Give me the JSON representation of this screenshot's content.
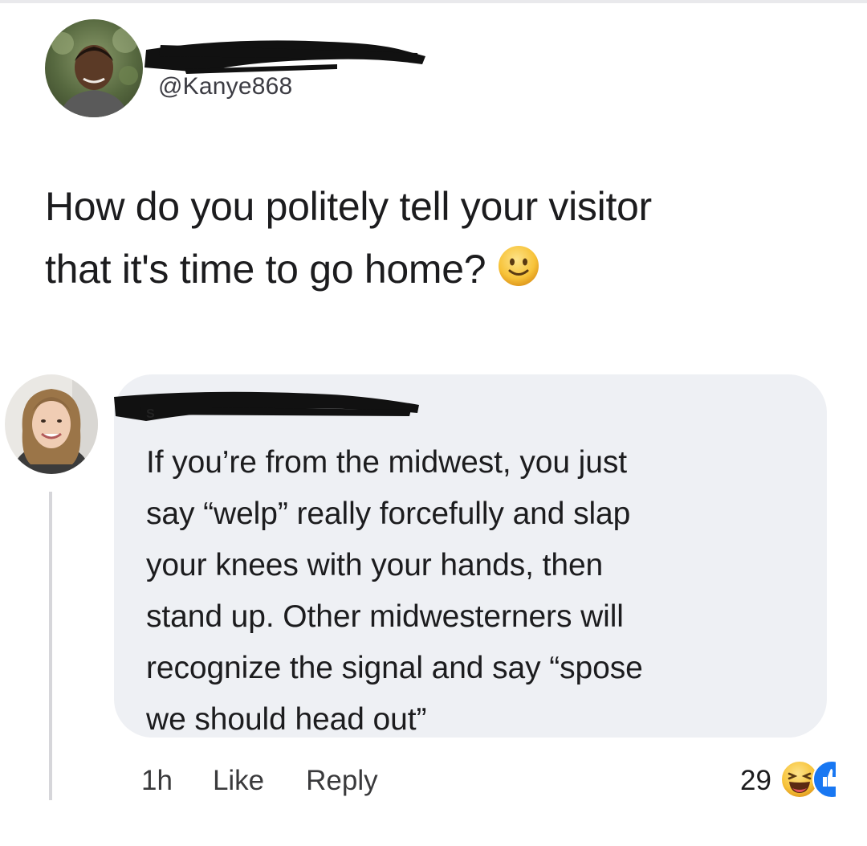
{
  "post": {
    "handle": "@Kanye868",
    "text_lines": [
      "How do you politely tell your visitor",
      "that it's time to go home?"
    ],
    "emoji": "slightly-smiling-face-icon"
  },
  "comment": {
    "text_lines": [
      "If you’re from the midwest, you just",
      "say “welp” really forcefully and slap",
      "your knees with your hands, then",
      "stand up. Other midwesterners will",
      "recognize the signal and say “spose",
      "we should head out”"
    ],
    "time": "1h",
    "like_label": "Like",
    "reply_label": "Reply",
    "reaction_count": "29",
    "reaction_icons": [
      "laughing-face-icon",
      "like-thumb-icon"
    ]
  },
  "colors": {
    "bubble": "#eef0f4",
    "text": "#1c1c1e",
    "meta": "#3a3a3c",
    "emoji_yellow": "#f7c339",
    "like_blue": "#1877f2"
  }
}
